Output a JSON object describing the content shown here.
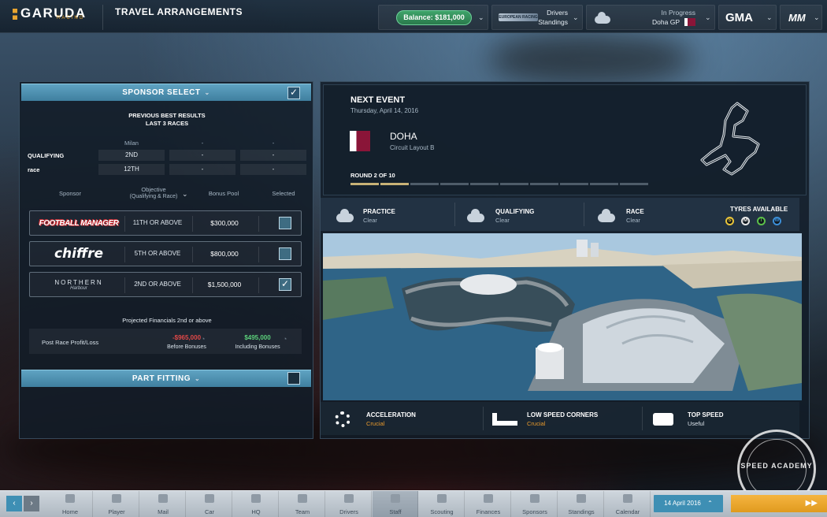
{
  "header": {
    "logo": "GARUDA",
    "logo_sub": "RACING",
    "screen_title": "TRAVEL ARRANGEMENTS",
    "balance": "Balance: $181,000",
    "standings_line1": "Drivers",
    "standings_line2": "Standings",
    "standings_badge": "EUROPEAN RACING",
    "status": "In Progress",
    "race": "Doha GP",
    "series_logo": "GMA",
    "brand_logo": "MM"
  },
  "sponsor_select": {
    "title": "SPONSOR SELECT",
    "checked": true,
    "prev_title": "PREVIOUS BEST RESULTS",
    "prev_sub": "LAST 3 RACES",
    "race_columns": [
      "Milan",
      "-",
      "-"
    ],
    "rows": [
      {
        "label": "QUALIFYING",
        "values": [
          "2ND",
          "-",
          "-"
        ]
      },
      {
        "label": "race",
        "values": [
          "12TH",
          "-",
          "-"
        ]
      }
    ],
    "col_sponsor": "Sponsor",
    "col_objective_1": "Objective",
    "col_objective_2": "(Qualifying & Race)",
    "col_bonus": "Bonus Pool",
    "col_selected": "Selected",
    "sponsors": [
      {
        "name": "FOOTBALL MANAGER",
        "objective": "11TH OR ABOVE",
        "bonus": "$300,000",
        "selected": false
      },
      {
        "name": "chiffre",
        "objective": "5TH OR ABOVE",
        "bonus": "$800,000",
        "selected": false
      },
      {
        "name": "NORTHERN",
        "name_sub": "Harbour",
        "objective": "2ND OR ABOVE",
        "bonus": "$1,500,000",
        "selected": true
      }
    ],
    "projected_title": "Projected Financials 2nd or above",
    "profit_label": "Post Race Profit/Loss",
    "before_value": "-$965,000",
    "before_label": "Before Bonuses",
    "including_value": "$495,000",
    "including_label": "Including Bonuses"
  },
  "part_fitting": {
    "title": "PART FITTING",
    "checked": false
  },
  "next_event": {
    "title": "NEXT EVENT",
    "date": "Thursday, April 14, 2016",
    "location": "DOHA",
    "layout": "Circuit Layout B",
    "round": "ROUND 2 OF 10",
    "round_current": 2,
    "round_total": 10,
    "sessions": [
      {
        "name": "PRACTICE",
        "weather": "Clear"
      },
      {
        "name": "QUALIFYING",
        "weather": "Clear"
      },
      {
        "name": "RACE",
        "weather": "Clear"
      }
    ],
    "tyres_title": "TYRES AVAILABLE",
    "tyres": [
      {
        "letter": "S",
        "color": "#e8c43a"
      },
      {
        "letter": "M",
        "color": "#e8e8e8"
      },
      {
        "letter": "I",
        "color": "#5cc04a"
      },
      {
        "letter": "W",
        "color": "#3c8fd8"
      }
    ],
    "characteristics": [
      {
        "name": "ACCELERATION",
        "value": "Crucial",
        "icon": "gear-icon"
      },
      {
        "name": "LOW SPEED CORNERS",
        "value": "Crucial",
        "icon": "corner-icon"
      },
      {
        "name": "TOP SPEED",
        "value": "Useful",
        "icon": "engine-icon"
      }
    ]
  },
  "nav": {
    "items": [
      "Home",
      "Player",
      "Mail",
      "Car",
      "HQ",
      "Team",
      "Drivers",
      "Staff",
      "Scouting",
      "Finances",
      "Sponsors",
      "Standings",
      "Calendar"
    ],
    "active": "Staff",
    "date": "14 April 2016"
  },
  "watermark": "SPEED ACADEMY"
}
